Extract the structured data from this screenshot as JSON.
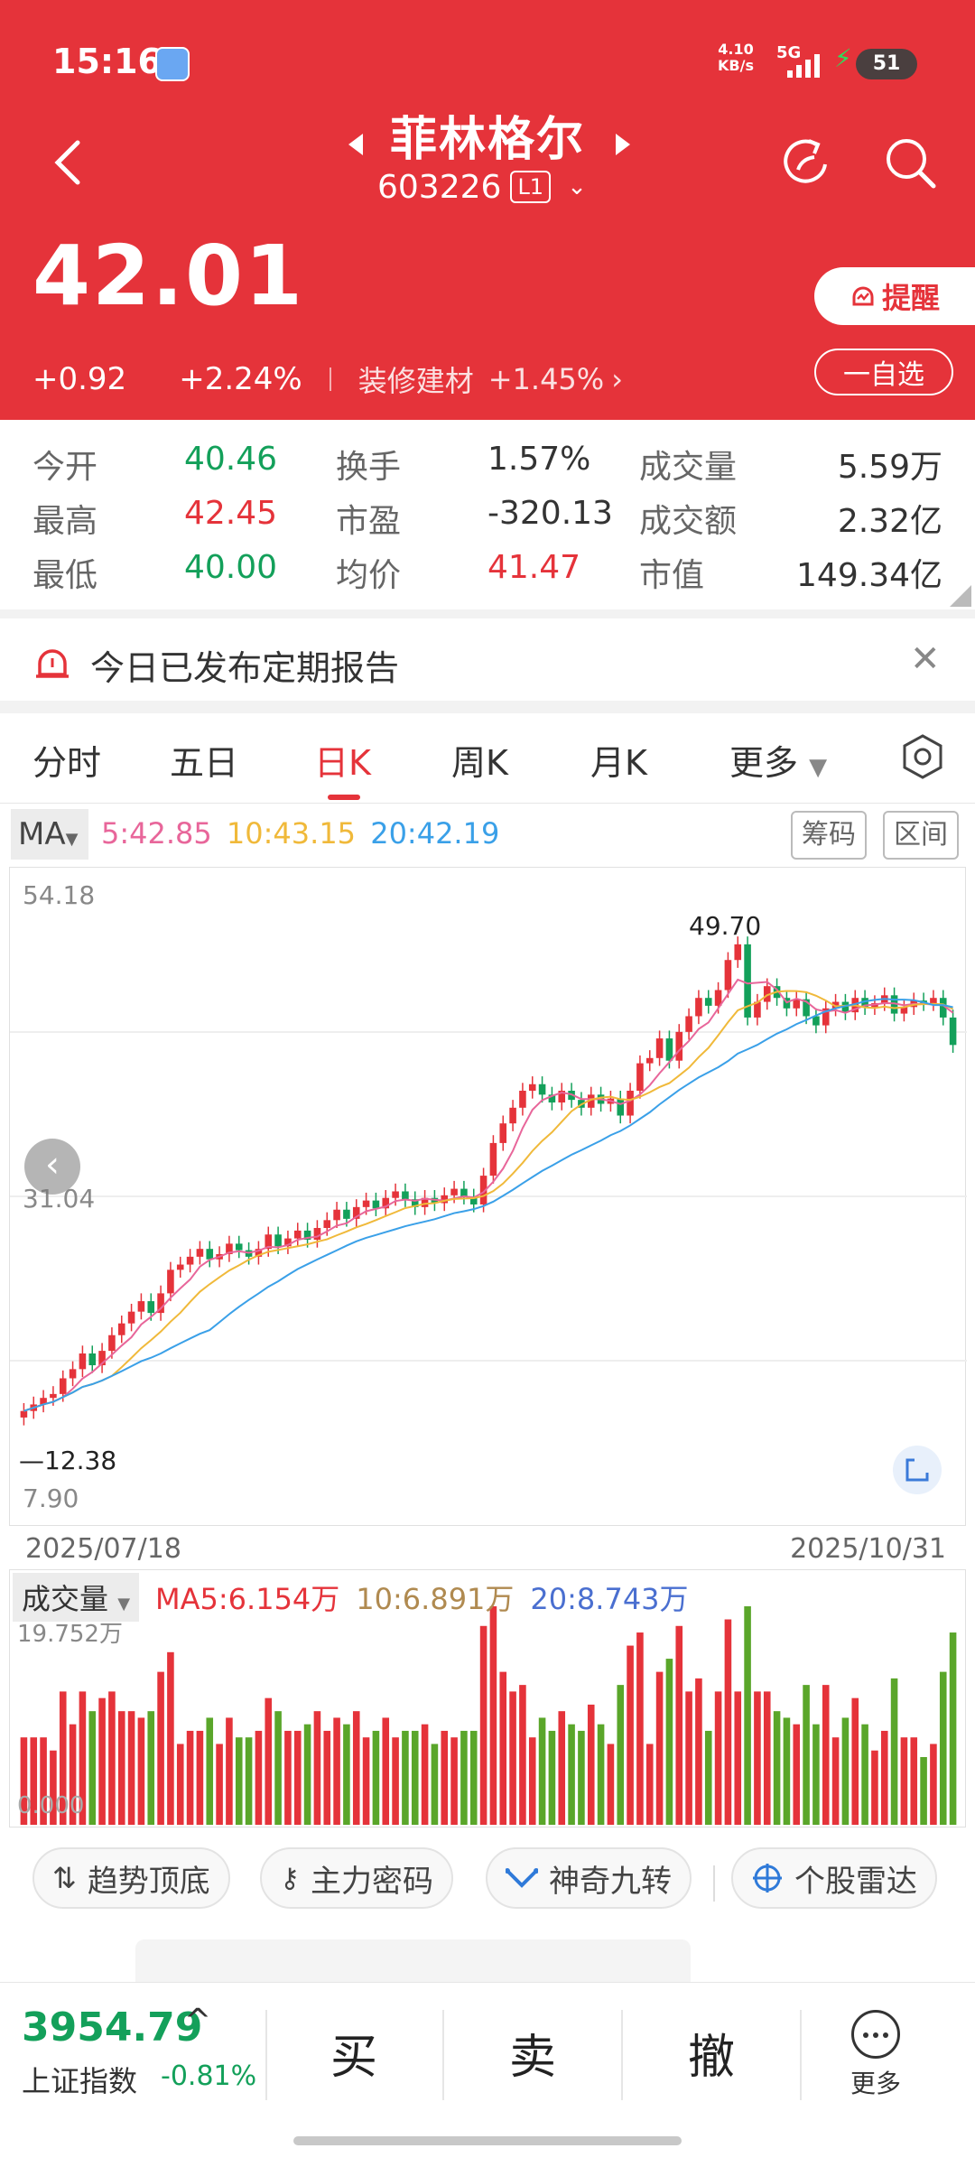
{
  "status_bar": {
    "time": "15:16",
    "net_speed_value": "4.10",
    "net_speed_unit": "KB/s",
    "network": "5G",
    "battery": "51"
  },
  "header": {
    "stock_name": "菲林格尔",
    "stock_code": "603226",
    "level": "L1",
    "price": "42.01",
    "change": "+0.92",
    "change_pct": "+2.24%",
    "sector": "装修建材",
    "sector_change": "+1.45%",
    "sector_arrow": "›",
    "remind_label": "提醒",
    "watchlist_label": "一自选"
  },
  "quote": {
    "open_label": "今开",
    "open": "40.46",
    "high_label": "最高",
    "high": "42.45",
    "low_label": "最低",
    "low": "40.00",
    "turnover_label": "换手",
    "turnover": "1.57%",
    "pe_label": "市盈",
    "pe": "-320.13",
    "avg_label": "均价",
    "avg": "41.47",
    "volume_label": "成交量",
    "volume": "5.59万",
    "amount_label": "成交额",
    "amount": "2.32亿",
    "mcap_label": "市值",
    "mcap": "149.34亿"
  },
  "notice": {
    "text": "今日已发布定期报告",
    "close": "✕"
  },
  "tabs": [
    {
      "label": "分时"
    },
    {
      "label": "五日"
    },
    {
      "label": "日K"
    },
    {
      "label": "周K"
    },
    {
      "label": "月K"
    },
    {
      "label": "更多"
    }
  ],
  "ma_bar": {
    "selector": "MA",
    "ma5": "5:42.85",
    "ma10": "10:43.15",
    "ma20": "20:42.19",
    "chips_label": "筹码",
    "range_label": "区间"
  },
  "kchart_labels": {
    "y_top": "54.18",
    "y_mid": "31.04",
    "y_bottom": "7.90",
    "max_label": "49.70",
    "min_label": "12.38",
    "date_start": "2025/07/18",
    "date_end": "2025/10/31"
  },
  "volume_chart": {
    "selector": "成交量",
    "ma5": "MA5:6.154万",
    "ma10": "10:6.891万",
    "ma20": "20:8.743万",
    "y_top": "19.752万",
    "y_bottom": "0.000"
  },
  "tools": [
    {
      "label": "趋势顶底"
    },
    {
      "label": "主力密码"
    },
    {
      "label": "神奇九转"
    },
    {
      "label": "个股雷达"
    }
  ],
  "bottom": {
    "index_value": "3954.79",
    "index_arrow": "^",
    "index_name": "上证指数",
    "index_change": "-0.81%",
    "buy": "买",
    "sell": "卖",
    "cancel": "撤",
    "more": "更多"
  },
  "colors": {
    "brand_red": "#e5333a",
    "down_green": "#13a05a",
    "ma5": "#e8669a",
    "ma10": "#f0b93a",
    "ma20": "#3aa0e8",
    "vol_ma10": "#b08a50",
    "vol_ma20": "#4a6fd0"
  },
  "chart_data": {
    "type": "candlestick",
    "ylim": [
      7.9,
      54.18
    ],
    "x_start": "2025/07/18",
    "x_end": "2025/10/31",
    "closes": [
      14,
      14.5,
      15,
      15.3,
      16.5,
      17.2,
      18.4,
      17.5,
      18.6,
      19.8,
      20.7,
      21.6,
      22.4,
      21.5,
      23,
      24.8,
      25.2,
      25.8,
      26.4,
      25.6,
      26,
      26.8,
      26.3,
      25.8,
      26.4,
      27.5,
      26.6,
      27.2,
      27.8,
      27.1,
      28,
      28.6,
      29.4,
      28.7,
      29.6,
      30.1,
      29.5,
      30.3,
      30.8,
      30.2,
      29.6,
      30.3,
      29.9,
      30.5,
      31,
      30.4,
      29.8,
      32,
      34.5,
      36,
      37.2,
      38.5,
      39,
      38.2,
      37.6,
      38.5,
      37.8,
      37.2,
      38.2,
      37.5,
      37.9,
      36.6,
      38.5,
      40.6,
      41,
      42.5,
      40.8,
      43,
      44.2,
      45.6,
      45,
      46.2,
      48.5,
      49.7,
      44.1,
      45.3,
      46.5,
      45.6,
      44.8,
      45.5,
      44.2,
      43.5,
      44.8,
      45.3,
      44.5,
      45.6,
      44.9,
      45.2,
      45.8,
      44.4,
      44.9,
      45.4,
      45.2,
      45.6,
      44.1,
      42.0
    ]
  }
}
